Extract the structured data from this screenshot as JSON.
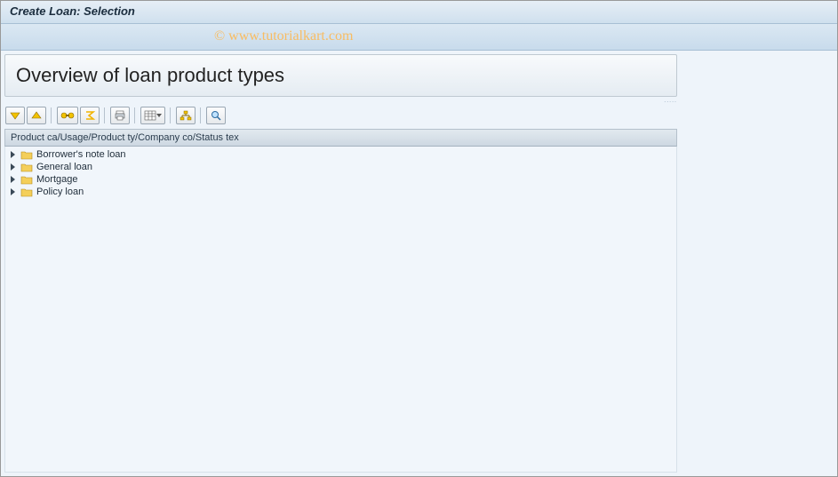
{
  "window": {
    "title": "Create Loan: Selection"
  },
  "watermark": "© www.tutorialkart.com",
  "heading": "Overview of loan product types",
  "toolbar": {
    "expand_all": "expand-all",
    "collapse_all": "collapse-all",
    "find": "find",
    "sum": "sum",
    "print": "print",
    "layout": "layout",
    "tree": "tree",
    "detail": "detail"
  },
  "column_header": "Product ca/Usage/Product ty/Company co/Status tex",
  "tree": {
    "items": [
      {
        "label": "Borrower's note loan"
      },
      {
        "label": "General loan"
      },
      {
        "label": "Mortgage"
      },
      {
        "label": "Policy loan"
      }
    ]
  }
}
